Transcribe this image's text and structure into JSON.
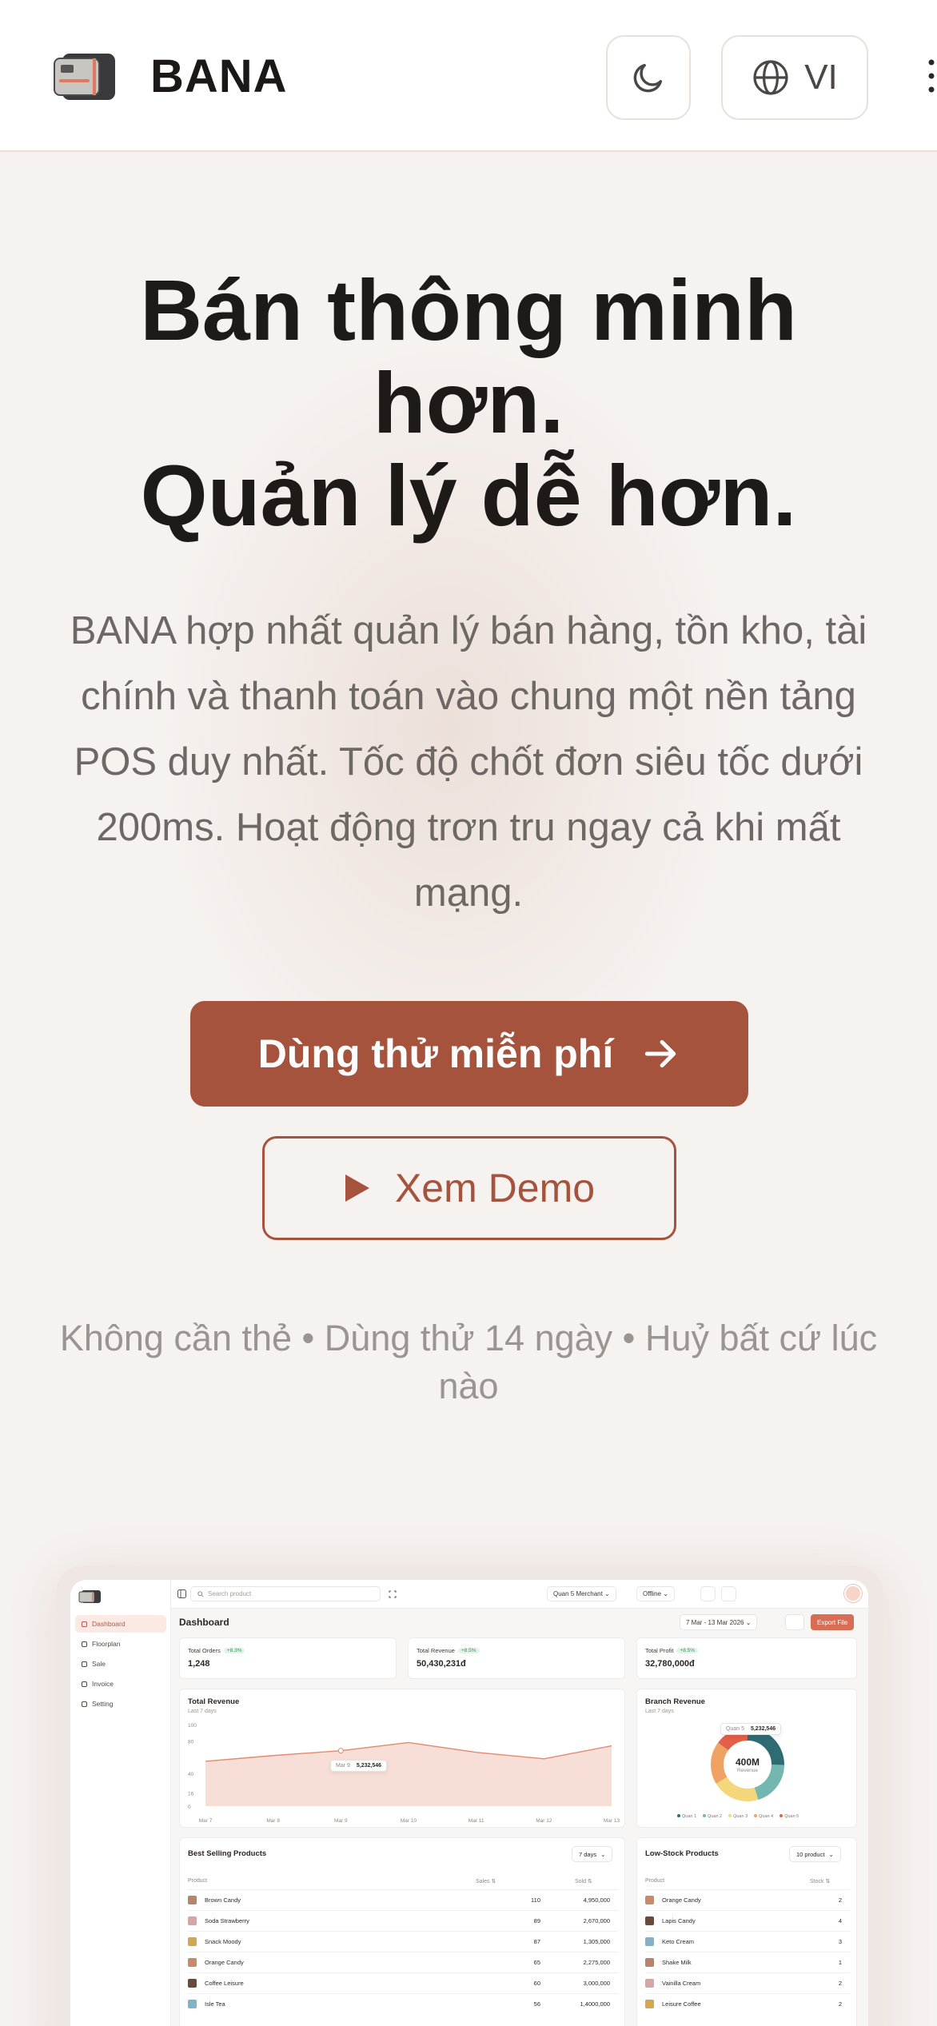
{
  "header": {
    "brand": "BANA",
    "lang": "VI"
  },
  "hero": {
    "headline_line1": "Bán thông minh",
    "headline_line2": "hơn.",
    "headline_line3": "Quản lý dễ hơn.",
    "subtext": "BANA hợp nhất quản lý bán hàng, tồn kho, tài chính và thanh toán vào chung một nền tảng POS duy nhất. Tốc độ chốt đơn siêu tốc dưới 200ms. Hoạt động trơn tru ngay cả khi mất mạng.",
    "cta_primary": "Dùng thử miễn phí",
    "cta_secondary": "Xem Demo",
    "note": "Không cần thẻ • Dùng thử 14 ngày • Huỷ bất cứ lúc nào"
  },
  "colors": {
    "accent": "#a6533d",
    "export": "#d86d55"
  },
  "dashboard": {
    "sidebar": [
      "Dashboard",
      "Floorplan",
      "Sale",
      "Invoice",
      "Setting"
    ],
    "search_placeholder": "Search product",
    "merchant": "Quan 5 Merchant",
    "status": "Offline",
    "title": "Dashboard",
    "date_range": "7 Mar - 13 Mar 2026",
    "export": "Export File",
    "stats": [
      {
        "label": "Total Orders",
        "pct": "+8.3%",
        "value": "1,248"
      },
      {
        "label": "Total Revenue",
        "pct": "+8.5%",
        "value": "50,430,231đ"
      },
      {
        "label": "Total Profit",
        "pct": "+8.5%",
        "value": "32,780,000đ"
      }
    ],
    "revenue": {
      "title": "Total Revenue",
      "sub": "Last 7 days",
      "y_ticks": [
        "100",
        "80",
        "40",
        "16",
        "0"
      ],
      "x_ticks": [
        "Mar 7",
        "Mar 8",
        "Mar 9",
        "Mar 10",
        "Mar 11",
        "Mar 12",
        "Mar 13"
      ],
      "tooltip_date": "Mar 9",
      "tooltip_value": "5,232,546"
    },
    "branch": {
      "title": "Branch Revenue",
      "sub": "Last 7 days",
      "center_value": "400M",
      "center_label": "Revenue",
      "tooltip_label": "Quan 5",
      "tooltip_value": "5,232,546",
      "legend": [
        "Quan 1",
        "Quan 2",
        "Quan 3",
        "Quan 4",
        "Quan 5"
      ]
    },
    "best": {
      "title": "Best Selling Products",
      "range": "7 days",
      "headers": [
        "Product",
        "Sales ⇅",
        "Sold ⇅"
      ],
      "rows": [
        [
          "Brown Candy",
          "110",
          "4,950,000"
        ],
        [
          "Soda Strawberry",
          "89",
          "2,670,000"
        ],
        [
          "Snack Moody",
          "87",
          "1,305,000"
        ],
        [
          "Orange Candy",
          "65",
          "2,275,000"
        ],
        [
          "Coffee Leisure",
          "60",
          "3,000,000"
        ],
        [
          "Isle Tea",
          "56",
          "1,4000,000"
        ]
      ]
    },
    "low": {
      "title": "Low-Stock Products",
      "range": "10 product",
      "headers": [
        "Product",
        "Stock ⇅"
      ],
      "rows": [
        [
          "Orange Candy",
          "2"
        ],
        [
          "Lapis Candy",
          "4"
        ],
        [
          "Keto Cream",
          "3"
        ],
        [
          "Shake Milk",
          "1"
        ],
        [
          "Vainilla Cream",
          "2"
        ],
        [
          "Leisure Coffee",
          "2"
        ]
      ]
    }
  },
  "chart_data": {
    "type": "area",
    "title": "Total Revenue",
    "x": [
      "Mar 7",
      "Mar 8",
      "Mar 9",
      "Mar 10",
      "Mar 11",
      "Mar 12",
      "Mar 13"
    ],
    "values": [
      55,
      62,
      68,
      78,
      66,
      58,
      74
    ],
    "ylim": [
      0,
      100
    ]
  }
}
